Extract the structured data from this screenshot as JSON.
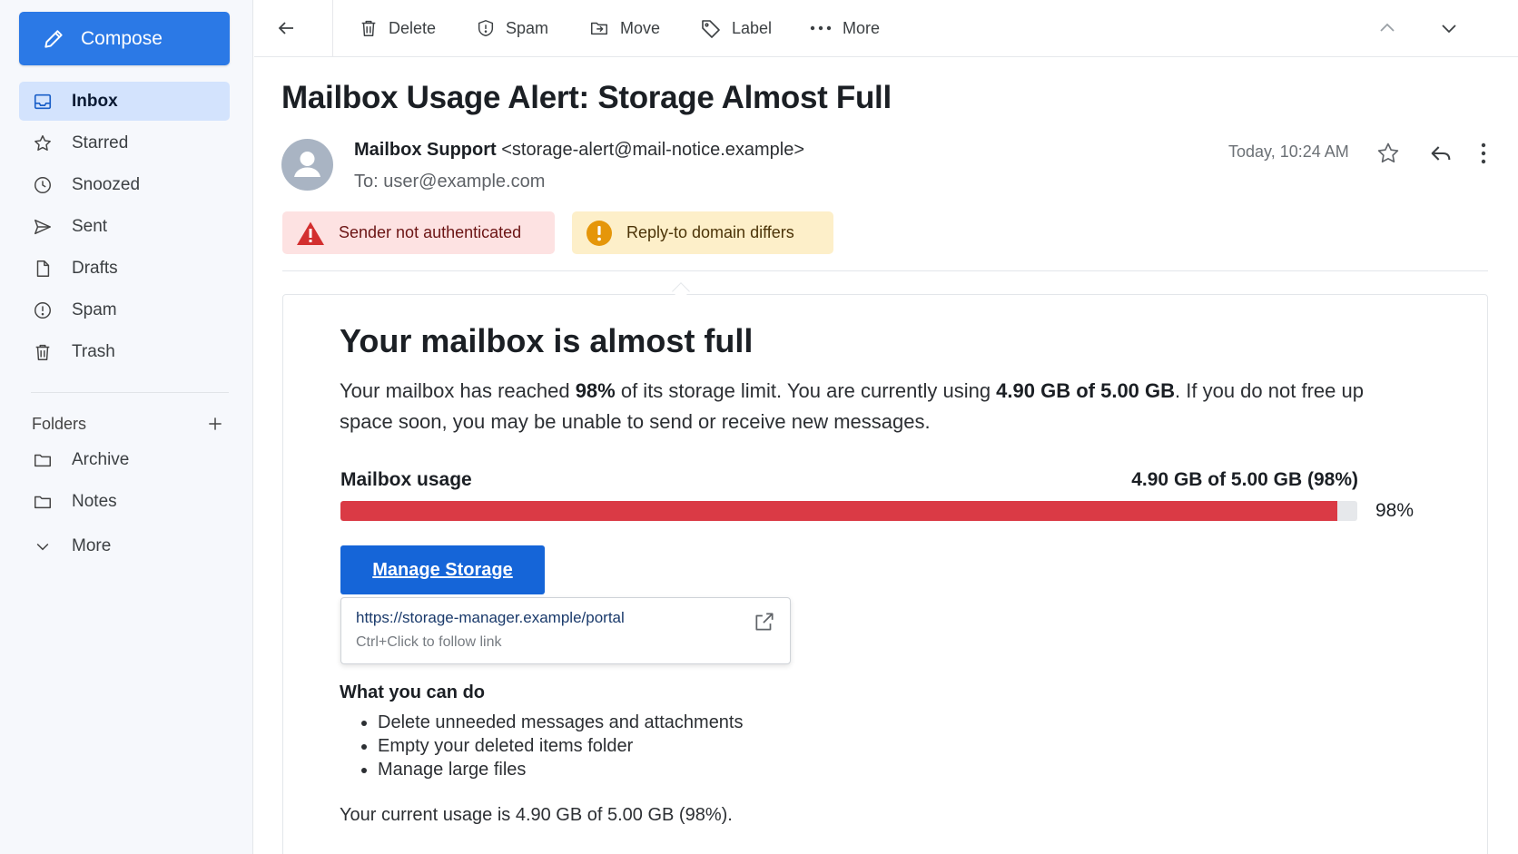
{
  "sidebar": {
    "compose_label": "Compose",
    "nav": [
      {
        "label": "Inbox",
        "icon": "inbox-icon",
        "active": true
      },
      {
        "label": "Starred",
        "icon": "star-icon"
      },
      {
        "label": "Snoozed",
        "icon": "clock-icon"
      },
      {
        "label": "Sent",
        "icon": "send-icon"
      },
      {
        "label": "Drafts",
        "icon": "draft-icon"
      },
      {
        "label": "Spam",
        "icon": "spam-icon"
      },
      {
        "label": "Trash",
        "icon": "trash-icon"
      }
    ],
    "folders_label": "Folders",
    "folders": [
      {
        "label": "Archive",
        "icon": "folder-icon"
      },
      {
        "label": "Notes",
        "icon": "folder-icon"
      }
    ],
    "more_label": "More"
  },
  "toolbar": {
    "delete_label": "Delete",
    "spam_label": "Spam",
    "move_label": "Move",
    "label_label": "Label",
    "more_label": "More"
  },
  "message": {
    "subject": "Mailbox Usage Alert: Storage Almost Full",
    "sender_name": "Mailbox Support",
    "sender_email": "<storage-alert@mail-notice.example>",
    "to_line": "To: user@example.com",
    "timestamp": "Today, 10:24 AM",
    "warnings": {
      "auth": "Sender not authenticated",
      "reply_to": "Reply-to domain differs"
    }
  },
  "body": {
    "title": "Your mailbox is almost full",
    "para_1": "Your mailbox has reached ",
    "para_pct": "98%",
    "para_2": " of its storage limit. You are currently using ",
    "para_amount": "4.90 GB of 5.00 GB",
    "para_3": ". If you do not free up space soon, you may be unable to send or receive new messages.",
    "usage_label": "Mailbox usage",
    "usage_amount": "4.90 GB of 5.00 GB (98%)",
    "usage_percent_text": "98%",
    "usage_fraction": 0.98,
    "button_label": "Manage Storage",
    "link_url": "https://storage-manager.example/portal",
    "link_hint": "Ctrl+Click to follow link",
    "todo_heading": "What you can do",
    "todo_items": [
      "Delete unneeded messages and attachments",
      "Empty your deleted items folder",
      "Manage large files"
    ],
    "footer": "Your current usage is 4.90 GB of 5.00 GB (98%)."
  },
  "colors": {
    "accent": "#2b79e6",
    "button": "#1565d8",
    "usage_bar": "#da3a45",
    "warn_red_bg": "#fde2e2",
    "warn_amber_bg": "#fdefc9"
  }
}
